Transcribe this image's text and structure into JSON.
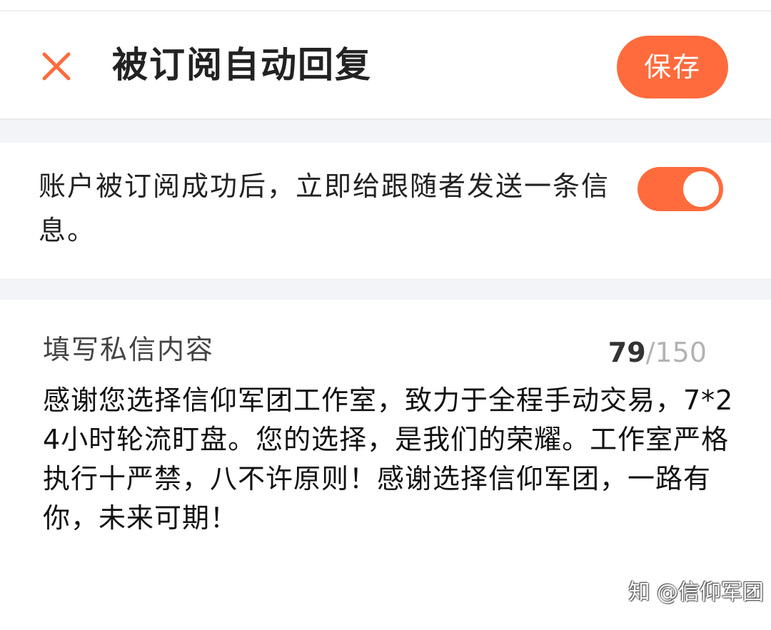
{
  "header": {
    "title": "被订阅自动回复",
    "save_label": "保存"
  },
  "auto_reply": {
    "label": "账户被订阅成功后，立即给跟随者发送一条信息。",
    "enabled": true
  },
  "message": {
    "field_label": "填写私信内容",
    "char_count": "79",
    "char_limit_suffix": "/150",
    "content": "感谢您选择信仰军团工作室，致力于全程手动交易，7*24小时轮流盯盘。您的选择，是我们的荣耀。工作室严格执行十严禁，八不许原则！感谢选择信仰军团，一路有你，未来可期！"
  },
  "watermark": "知 @信仰军团",
  "colors": {
    "accent": "#ff6b3d",
    "section_gap": "#f3f4f7"
  },
  "icons": {
    "close": "close-icon"
  }
}
